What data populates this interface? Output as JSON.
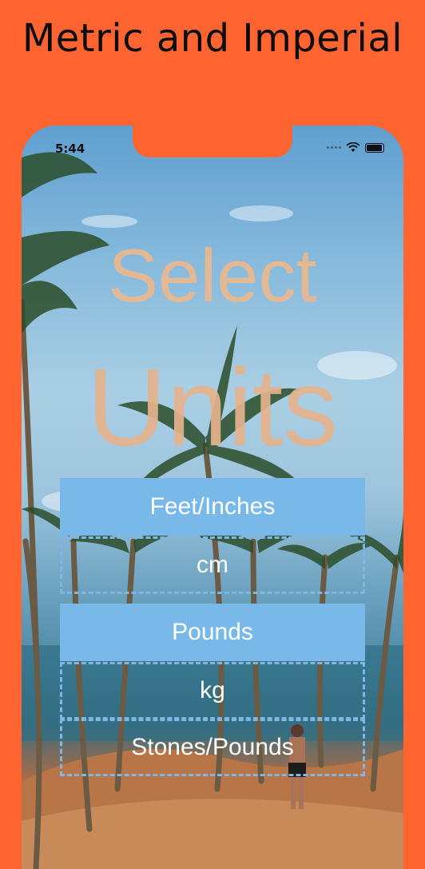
{
  "headline": "Metric and Imperial",
  "status": {
    "time": "5:44"
  },
  "title": {
    "line1": "Select",
    "line2": "Units"
  },
  "options": [
    {
      "label": "Feet/Inches",
      "selected": true
    },
    {
      "label": "cm",
      "selected": false
    },
    {
      "label": "Pounds",
      "selected": true
    },
    {
      "label": "kg",
      "selected": false
    },
    {
      "label": "Stones/Pounds",
      "selected": false
    }
  ],
  "colors": {
    "background": "#ff6431",
    "selected": "#79b9e9",
    "title": "#e5b38d"
  }
}
